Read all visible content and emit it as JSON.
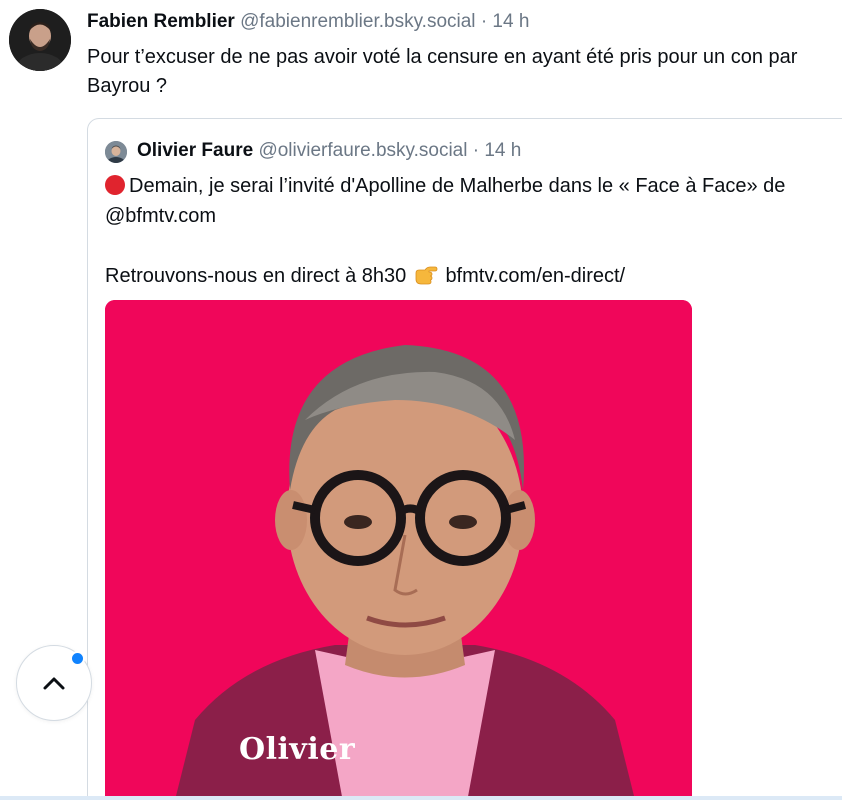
{
  "post": {
    "author_name": "Fabien Remblier",
    "author_handle": "@fabienremblier.bsky.social",
    "separator": "·",
    "timestamp": "14 h",
    "text": "Pour t’excuser de ne pas avoir voté la censure en ayant été pris pour un con par Bayrou ?"
  },
  "quote": {
    "author_name": "Olivier Faure",
    "author_handle": "@olivierfaure.bsky.social",
    "separator": "·",
    "timestamp": "14 h",
    "line1": "Demain, je serai l’invité d'Apolline de Malherbe dans le « Face à Face» de @bfmtv.com",
    "line2_prefix": "Retrouvons-nous en direct à 8h30",
    "line2_link": "bfmtv.com/en-direct/",
    "red_dot_icon": "red-circle-emoji",
    "pointer_icon": "backhand-index-pointing-right-emoji",
    "media": {
      "caption": "Olivier",
      "background_color": "#f0065a"
    }
  },
  "controls": {
    "scroll_top_icon": "chevron-up-icon",
    "notification_color": "#1083fe"
  }
}
